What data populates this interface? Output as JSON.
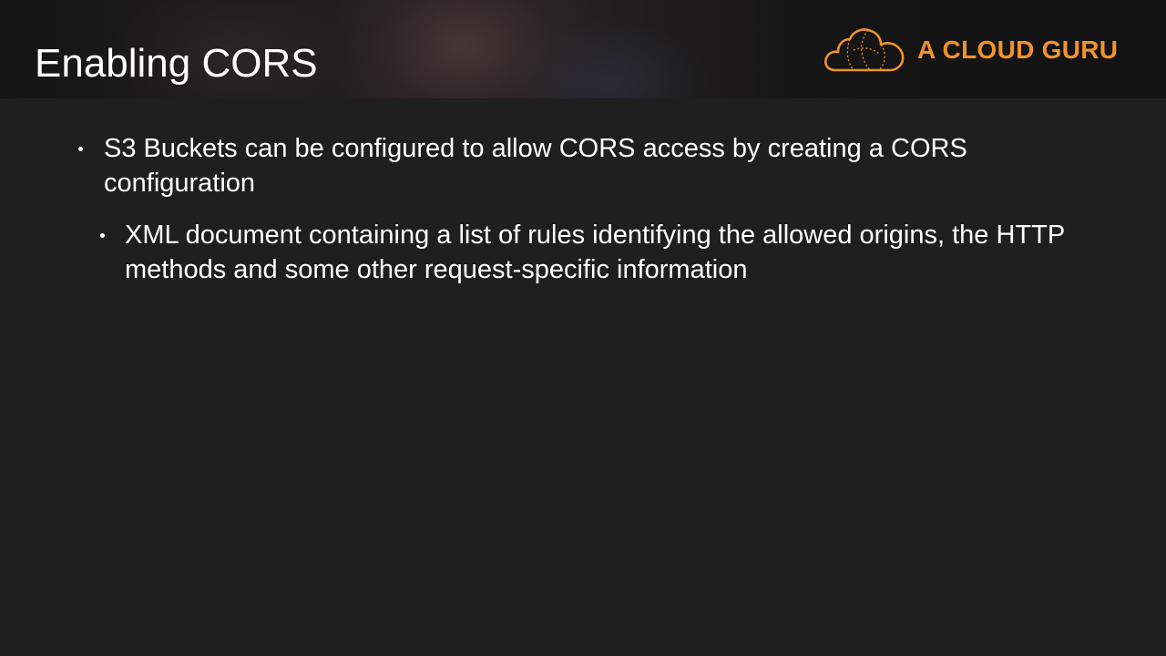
{
  "slide": {
    "title": "Enabling CORS",
    "logo": {
      "icon": "cloud-logo-icon",
      "text": "A CLOUD GURU",
      "color": "#f0922e"
    },
    "bullets": [
      {
        "text": "S3 Buckets can be configured to allow CORS access by creating a CORS configuration",
        "level": 1
      },
      {
        "text": "XML document containing a list of rules identifying the allowed origins, the HTTP methods and some other request-specific information",
        "level": 2
      }
    ]
  }
}
